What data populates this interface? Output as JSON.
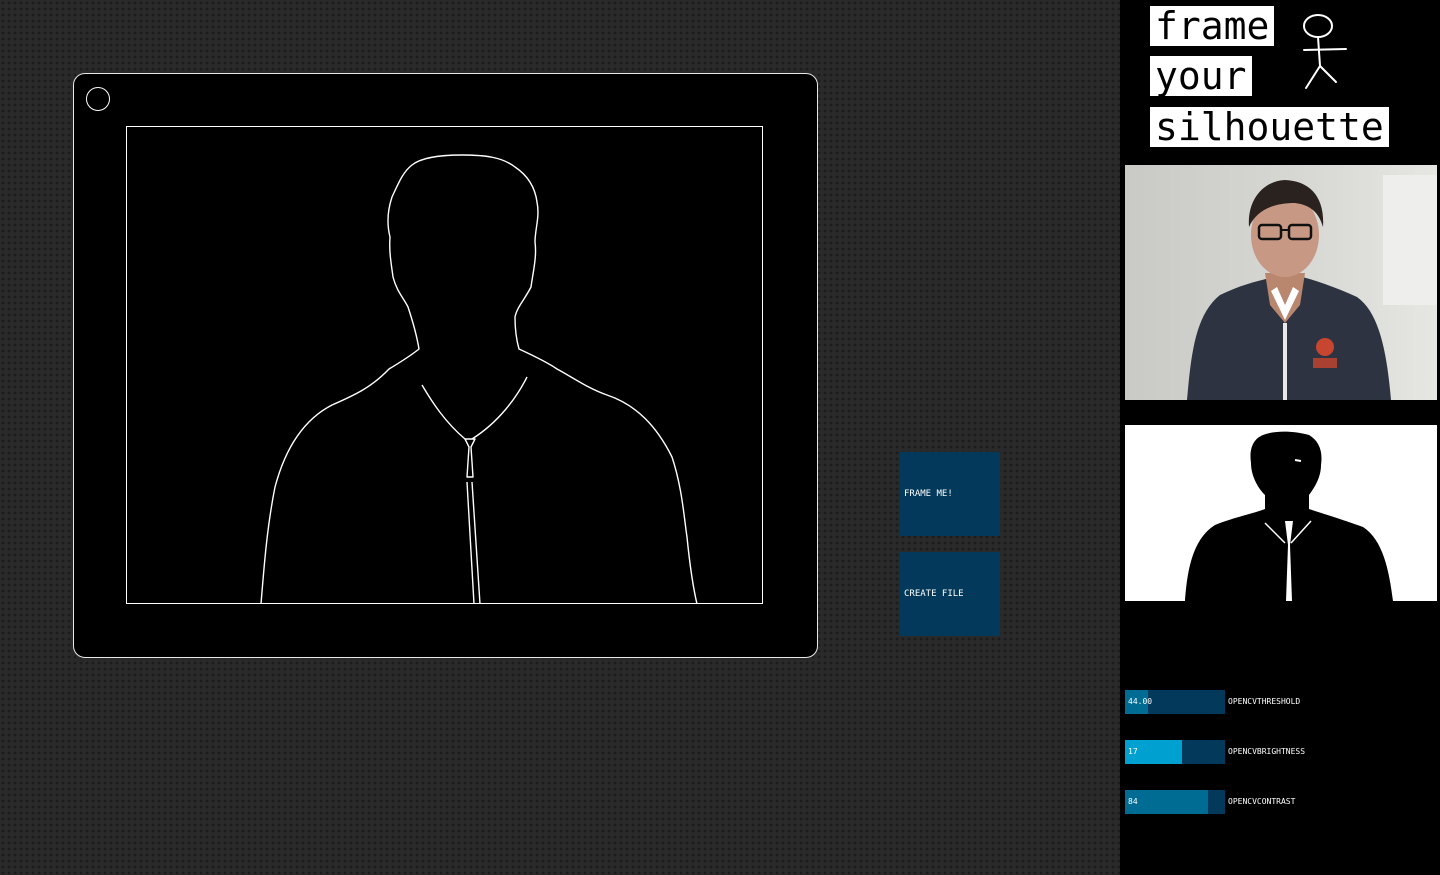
{
  "title": {
    "words": [
      "frame",
      "your",
      "silhouette"
    ]
  },
  "buttons": {
    "frame_me": "FRAME ME!",
    "create_file": "CREATE FILE"
  },
  "sliders": [
    {
      "name": "OPENCVTHRESHOLD",
      "value": "44.00",
      "fill_fraction": 0.23,
      "fill_color": "#016c93"
    },
    {
      "name": "OPENCVBRIGHTNESS",
      "value": "17",
      "fill_fraction": 0.57,
      "fill_color": "#00a0d0"
    },
    {
      "name": "OPENCVCONTRAST",
      "value": "84",
      "fill_fraction": 0.83,
      "fill_color": "#016c93"
    }
  ],
  "colors": {
    "background": "#2a2a2a",
    "panel": "#000000",
    "button": "#03395a",
    "slider_track": "#03395a",
    "slider_active": "#00a0d0",
    "slider_fill": "#016c93"
  },
  "icons": [
    "stick-figure-icon",
    "corner-hole-icon"
  ]
}
